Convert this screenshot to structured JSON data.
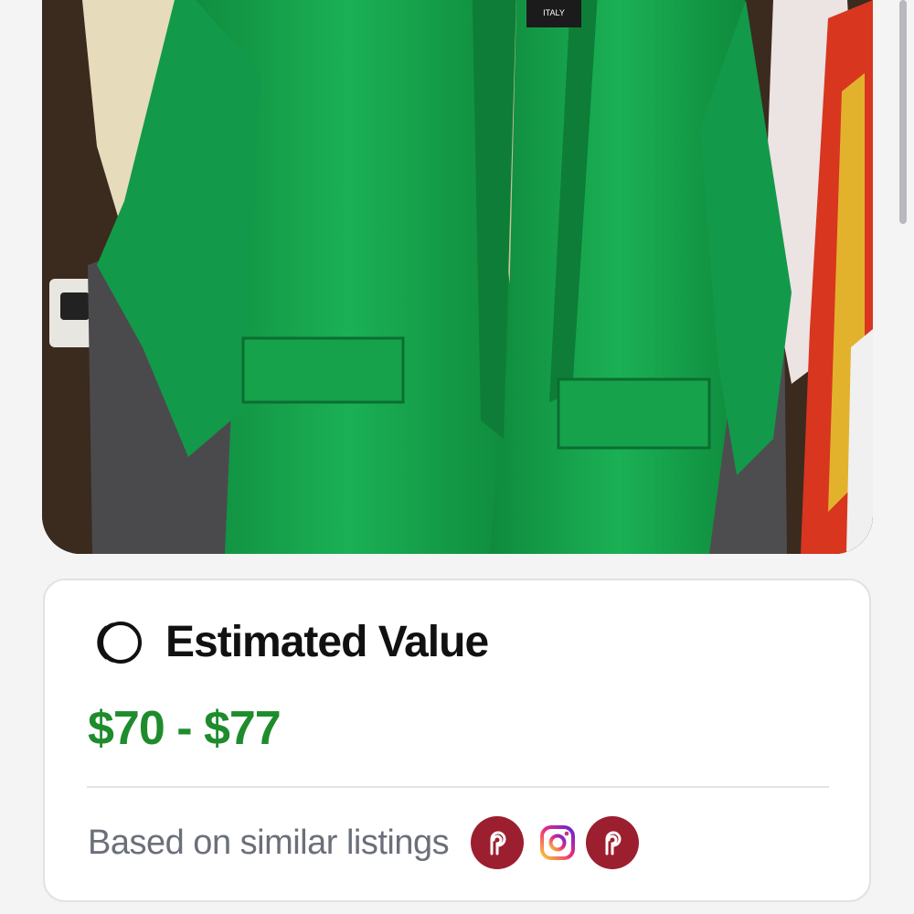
{
  "photo": {
    "tag_text": "ITALY",
    "colors": {
      "jacket": "#16a24a",
      "jacket_shadow": "#0c7a35",
      "wall": "#3a2a1f"
    }
  },
  "valuation": {
    "title": "Estimated Value",
    "price_range": "$70 - $77",
    "footer_text": "Based on similar listings",
    "sources": [
      "poshmark-icon",
      "instagram-icon",
      "poshmark-icon"
    ],
    "colors": {
      "price": "#1e8c2c",
      "poshmark": "#9c1f2f"
    }
  }
}
